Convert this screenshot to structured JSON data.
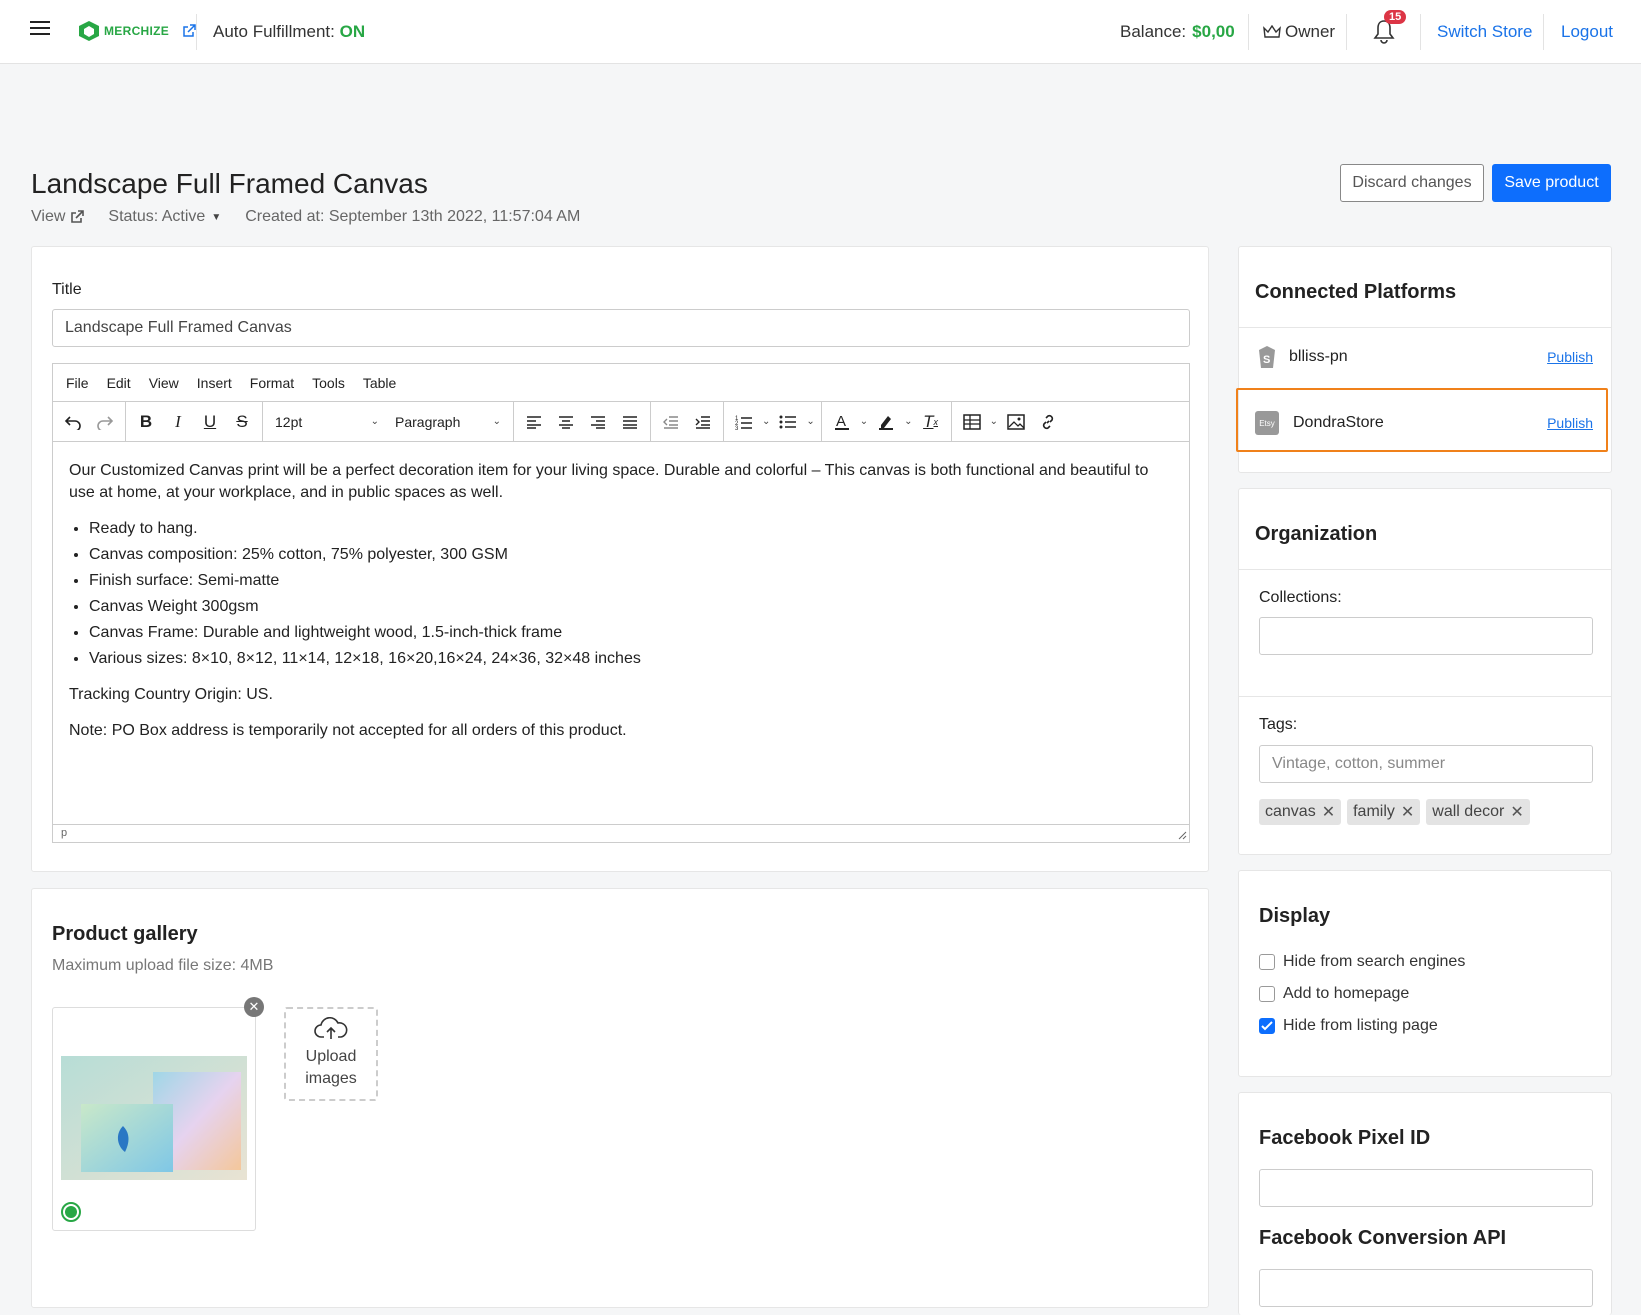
{
  "topbar": {
    "logo_text": "MERCHIZE",
    "auto_label": "Auto Fulfillment:",
    "auto_value": "ON",
    "balance_label": "Balance:",
    "balance_value": "$0,00",
    "owner_label": "Owner",
    "notif_count": "15",
    "switch_store": "Switch Store",
    "logout": "Logout"
  },
  "header": {
    "title": "Landscape Full Framed Canvas",
    "view_label": "View",
    "status": "Status: Active",
    "created": "Created at: September 13th 2022, 11:57:04 AM",
    "discard": "Discard changes",
    "save": "Save product"
  },
  "title_card": {
    "label": "Title",
    "value": "Landscape Full Framed Canvas"
  },
  "editor": {
    "menu": [
      "File",
      "Edit",
      "View",
      "Insert",
      "Format",
      "Tools",
      "Table"
    ],
    "font_size": "12pt",
    "block_format": "Paragraph",
    "para1": "Our Customized Canvas print will be a perfect decoration item for your living space.  Durable and colorful – This canvas is both functional and beautiful to use at home, at your workplace, and in public spaces as well.",
    "bullets": [
      "Ready to hang.",
      "Canvas composition: 25% cotton, 75% polyester, 300 GSM",
      "Finish surface: Semi-matte",
      "Canvas Weight 300gsm",
      "Canvas Frame: Durable and lightweight wood, 1.5-inch-thick frame",
      "Various sizes: 8×10, 8×12, 11×14, 12×18, 16×20,16×24, 24×36, 32×48 inches"
    ],
    "para2": "Tracking Country Origin: US.",
    "para3": "Note: PO Box address is temporarily not accepted for all orders of this product.",
    "status_path": "p"
  },
  "gallery": {
    "title": "Product gallery",
    "subtitle": "Maximum upload file size: 4MB",
    "upload_line1": "Upload",
    "upload_line2": "images"
  },
  "platforms": {
    "title": "Connected Platforms",
    "items": [
      {
        "name": "blliss-pn",
        "action": "Publish",
        "icon": "shopify-icon"
      },
      {
        "name": "DondraStore",
        "action": "Publish",
        "icon": "etsy-icon",
        "icon_text": "Etsy"
      }
    ]
  },
  "organization": {
    "title": "Organization",
    "collections_label": "Collections:",
    "tags_label": "Tags:",
    "tags_placeholder": "Vintage, cotton, summer",
    "tags": [
      "canvas",
      "family",
      "wall decor"
    ]
  },
  "display": {
    "title": "Display",
    "options": [
      {
        "label": "Hide from search engines",
        "checked": false
      },
      {
        "label": "Add to homepage",
        "checked": false
      },
      {
        "label": "Hide from listing page",
        "checked": true
      }
    ]
  },
  "facebook": {
    "pixel_title": "Facebook Pixel ID",
    "conversion_title": "Facebook Conversion API"
  },
  "colors": {
    "accent": "#0d6efd",
    "link": "#1a73e8",
    "success": "#28a745",
    "highlight": "#f0811a",
    "badge": "#dc3545"
  }
}
